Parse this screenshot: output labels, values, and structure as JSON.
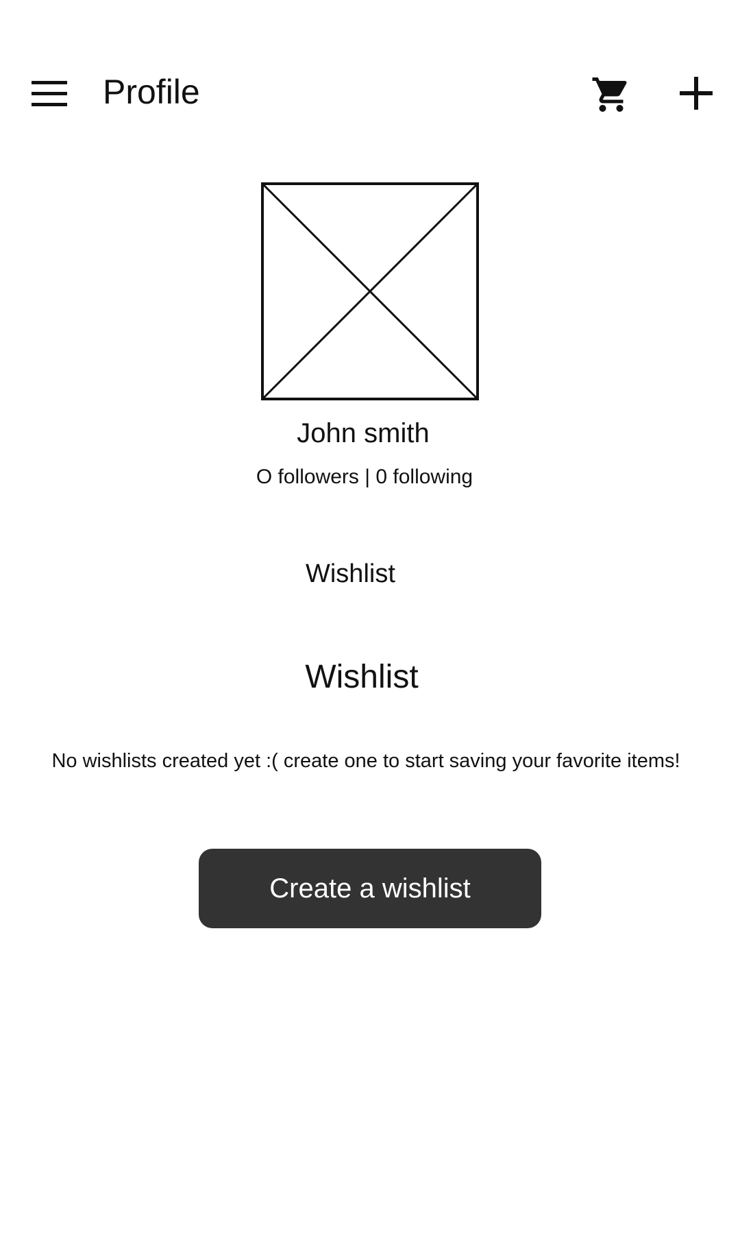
{
  "header": {
    "title": "Profile",
    "menu_icon": "hamburger-menu-icon",
    "cart_icon": "shopping-cart-icon",
    "add_icon": "plus-icon"
  },
  "profile": {
    "avatar_icon": "image-placeholder-icon",
    "name": "John smith",
    "stats": "O followers | 0 following"
  },
  "tabs": {
    "wishlist_label": "Wishlist"
  },
  "wishlist_section": {
    "title": "Wishlist",
    "empty_message": "No wishlists created yet :( create one to start saving your favorite items!",
    "create_button_label": "Create a wishlist"
  },
  "colors": {
    "button_background": "#333333",
    "button_text": "#ffffff",
    "text": "#111111",
    "background": "#ffffff"
  }
}
